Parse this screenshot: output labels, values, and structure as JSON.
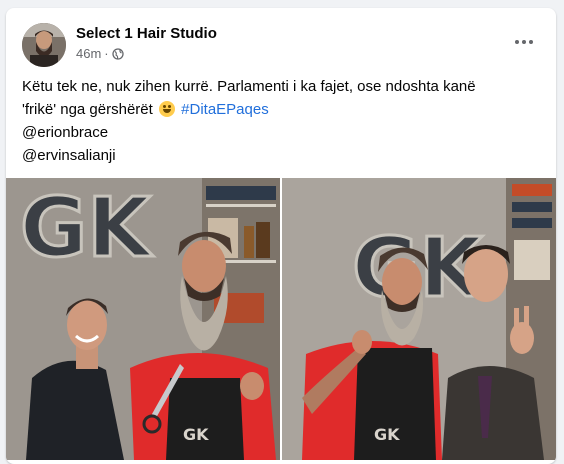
{
  "post": {
    "page_name": "Select 1 Hair Studio",
    "time": "46m",
    "dot": "·",
    "text_line1": "Këtu tek ne, nuk zihen kurrë. Parlamenti i ka fajet, ose ndoshta kanë",
    "text_line2_prefix": "'frikë' nga gërshërët",
    "hashtag": "#DitaEPaqes",
    "mention1": "@erionbrace",
    "mention2": "@ervinsalianji"
  },
  "images": {
    "wall_logo": "GK",
    "apron_logo": "GK"
  },
  "icons": {
    "globe": "globe-icon",
    "more": "more-options-icon",
    "emoji": "grinning-face-emoji"
  },
  "colors": {
    "link": "#216fdb",
    "meta": "#65676b",
    "shirt_red": "#e02b2b"
  }
}
